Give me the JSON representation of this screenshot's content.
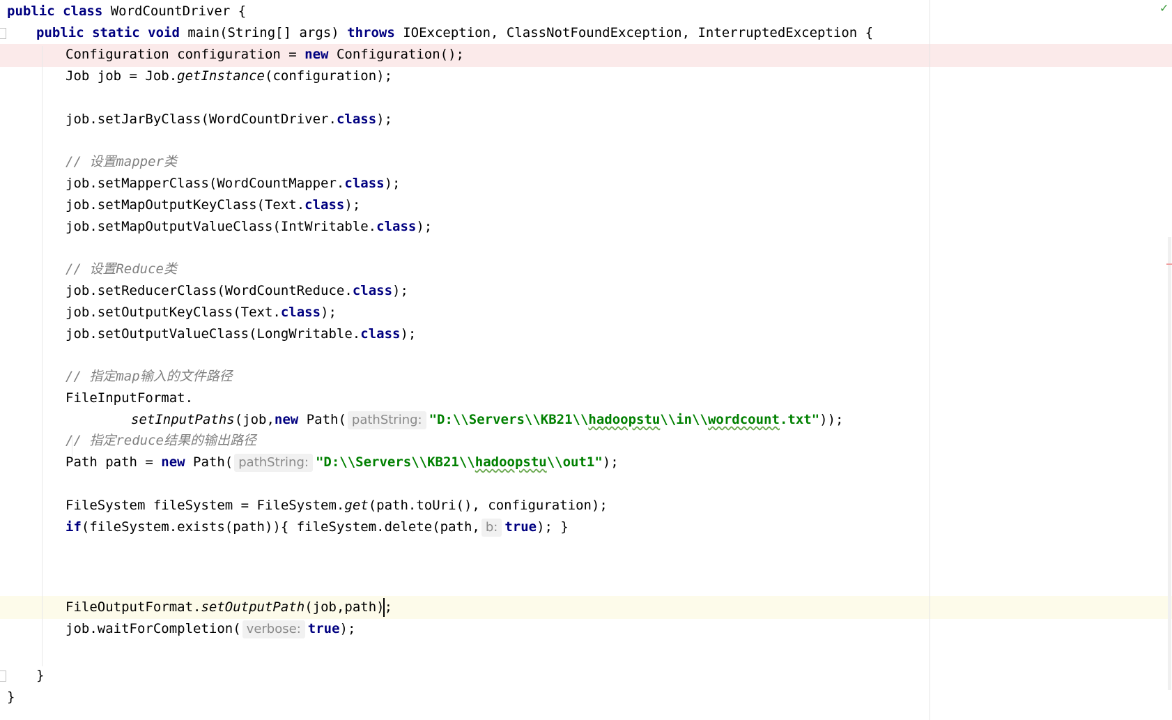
{
  "editor": {
    "lines": {
      "l1": {
        "kw1": "public class",
        "rest": " WordCountDriver {"
      },
      "l2": {
        "kw1": "public static void",
        "t1": " main(String[] args) ",
        "kw2": "throws",
        "t2": " IOException, ClassNotFoundException, InterruptedException {"
      },
      "l3": {
        "t1": "Configuration configuration = ",
        "kw1": "new",
        "t2": " Configuration();"
      },
      "l4": {
        "t1": "Job job = Job.",
        "it1": "getInstance",
        "t2": "(configuration);"
      },
      "l6": {
        "t1": "job.setJarByClass(WordCountDriver.",
        "kw1": "class",
        "t2": ");"
      },
      "l8": {
        "comment": "// 设置mapper类"
      },
      "l9": {
        "t1": "job.setMapperClass(WordCountMapper.",
        "kw1": "class",
        "t2": ");"
      },
      "l10": {
        "t1": "job.setMapOutputKeyClass(Text.",
        "kw1": "class",
        "t2": ");"
      },
      "l11": {
        "t1": "job.setMapOutputValueClass(IntWritable.",
        "kw1": "class",
        "t2": ");"
      },
      "l13": {
        "comment": "// 设置Reduce类"
      },
      "l14": {
        "t1": "job.setReducerClass(WordCountReduce.",
        "kw1": "class",
        "t2": ");"
      },
      "l15": {
        "t1": "job.setOutputKeyClass(Text.",
        "kw1": "class",
        "t2": ");"
      },
      "l16": {
        "t1": "job.setOutputValueClass(LongWritable.",
        "kw1": "class",
        "t2": ");"
      },
      "l18": {
        "comment": "// 指定map输入的文件路径"
      },
      "l19": {
        "t1": "FileInputFormat."
      },
      "l20": {
        "it1": "setInputPaths",
        "t1": "(job,",
        "kw1": "new",
        "t2": " Path(",
        "hint": "pathString:",
        "s1": "\"D:\\\\Servers\\\\KB21\\\\",
        "s2": "hadoopstu",
        "s3": "\\\\in\\\\",
        "s4": "wordcount",
        "s5": ".txt\"",
        "t3": "));"
      },
      "l21": {
        "comment": "// 指定reduce结果的输出路径"
      },
      "l22": {
        "t1": "Path path = ",
        "kw1": "new",
        "t2": " Path(",
        "hint": "pathString:",
        "s1": "\"D:\\\\Servers\\\\KB21\\\\",
        "s2": "hadoopstu",
        "s3": "\\\\out1\"",
        "t3": ");"
      },
      "l24": {
        "t1": "FileSystem fileSystem = FileSystem.",
        "it1": "get",
        "t2": "(path.toUri(), configuration);"
      },
      "l25": {
        "kw1": "if",
        "t1": "(fileSystem.exists(path)){ fileSystem.delete(path,",
        "hint": "b:",
        "kw2": "true",
        "t2": "); }"
      },
      "l27": {
        "t1": "FileOutputFormat.",
        "it1": "setOutputPath",
        "t2": "(job,path);"
      },
      "l28": {
        "t1": "job.waitForCompletion(",
        "hint": "verbose:",
        "kw1": "true",
        "t2": ");"
      },
      "l30": {
        "t1": "}"
      },
      "l31": {
        "t1": "}"
      }
    },
    "inspection_ok_icon": "checkmark-icon",
    "colors": {
      "keyword": "#000080",
      "string": "#008000",
      "comment": "#808080",
      "error_line": "#fbeaea",
      "caret_line": "#fdfbea"
    }
  }
}
